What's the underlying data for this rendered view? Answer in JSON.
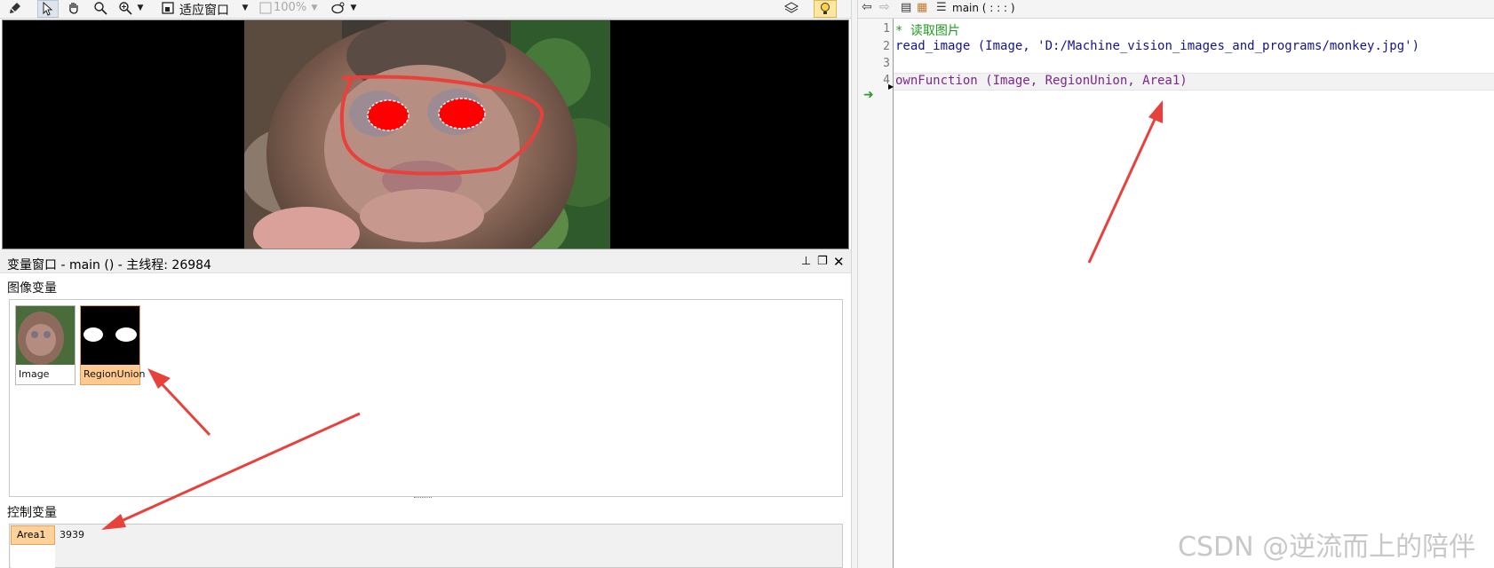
{
  "toolbar": {
    "fit_window_label": "适应窗口",
    "zoom_label": "100%"
  },
  "variable_window": {
    "title": "变量窗口 - main () - 主线程: 26984",
    "image_section_label": "图像变量",
    "control_section_label": "控制变量",
    "image_vars": [
      {
        "name": "Image"
      },
      {
        "name": "RegionUnion"
      }
    ],
    "control_vars": [
      {
        "name": "Area1",
        "value": "3939"
      }
    ]
  },
  "editor": {
    "proc_selector": "main ( : : : )",
    "lines": [
      {
        "num": "1",
        "text": "* 读取图片"
      },
      {
        "num": "2",
        "op": "read_image",
        "args": " (Image, 'D:/Machine_vision_images_and_programs/monkey.jpg')"
      },
      {
        "num": "3",
        "text": ""
      },
      {
        "num": "4",
        "op": "ownFunction",
        "args": " (Image, RegionUnion, Area1)"
      }
    ]
  },
  "watermark": "CSDN @逆流而上的陪伴",
  "colors": {
    "annotation_red": "#e8413c",
    "selected_thumb": "#ffc98f",
    "comment_green": "#1f9a1f",
    "keyword_blue": "#14148c",
    "proc_purple": "#7d2590"
  }
}
